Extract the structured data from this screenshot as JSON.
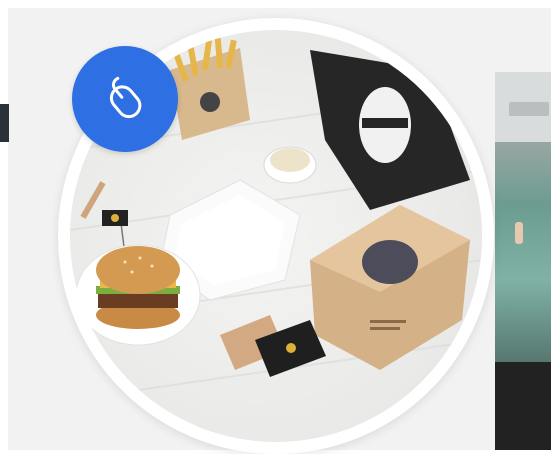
{
  "feature_card": {
    "badge_icon": "computer-mouse-icon",
    "accent_color": "#2f6fe4",
    "photo": "burger-packaging-mockup"
  },
  "neighbor_card": {
    "photo": "cafe-interior"
  }
}
